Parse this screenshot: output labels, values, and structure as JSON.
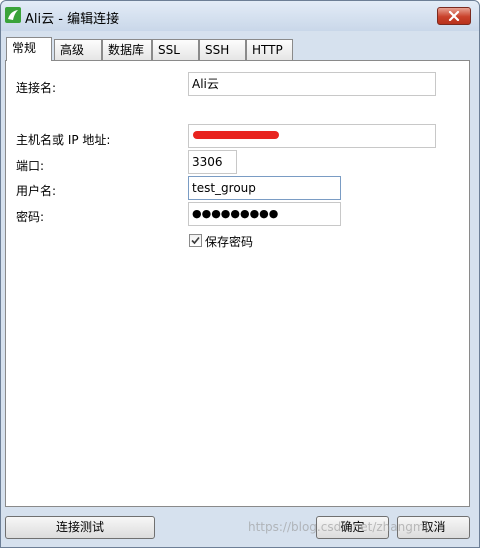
{
  "window": {
    "title": "Ali云 - 编辑连接",
    "close_glyph": "✕"
  },
  "tabs": [
    {
      "label": "常规",
      "active": true
    },
    {
      "label": "高级"
    },
    {
      "label": "数据库"
    },
    {
      "label": "SSL"
    },
    {
      "label": "SSH"
    },
    {
      "label": "HTTP"
    }
  ],
  "form": {
    "connection_name_label": "连接名:",
    "connection_name_value": "Ali云",
    "host_label": "主机名或 IP 地址:",
    "port_label": "端口:",
    "port_value": "3306",
    "username_label": "用户名:",
    "username_value": "test_group",
    "password_label": "密码:",
    "password_value": "●●●●●●●●●",
    "save_password_label": "保存密码",
    "save_password_checked": true
  },
  "buttons": {
    "test_connection": "连接测试",
    "ok": "确定",
    "cancel": "取消"
  },
  "watermark": "https://blog.csdn.net/zhangmi..."
}
